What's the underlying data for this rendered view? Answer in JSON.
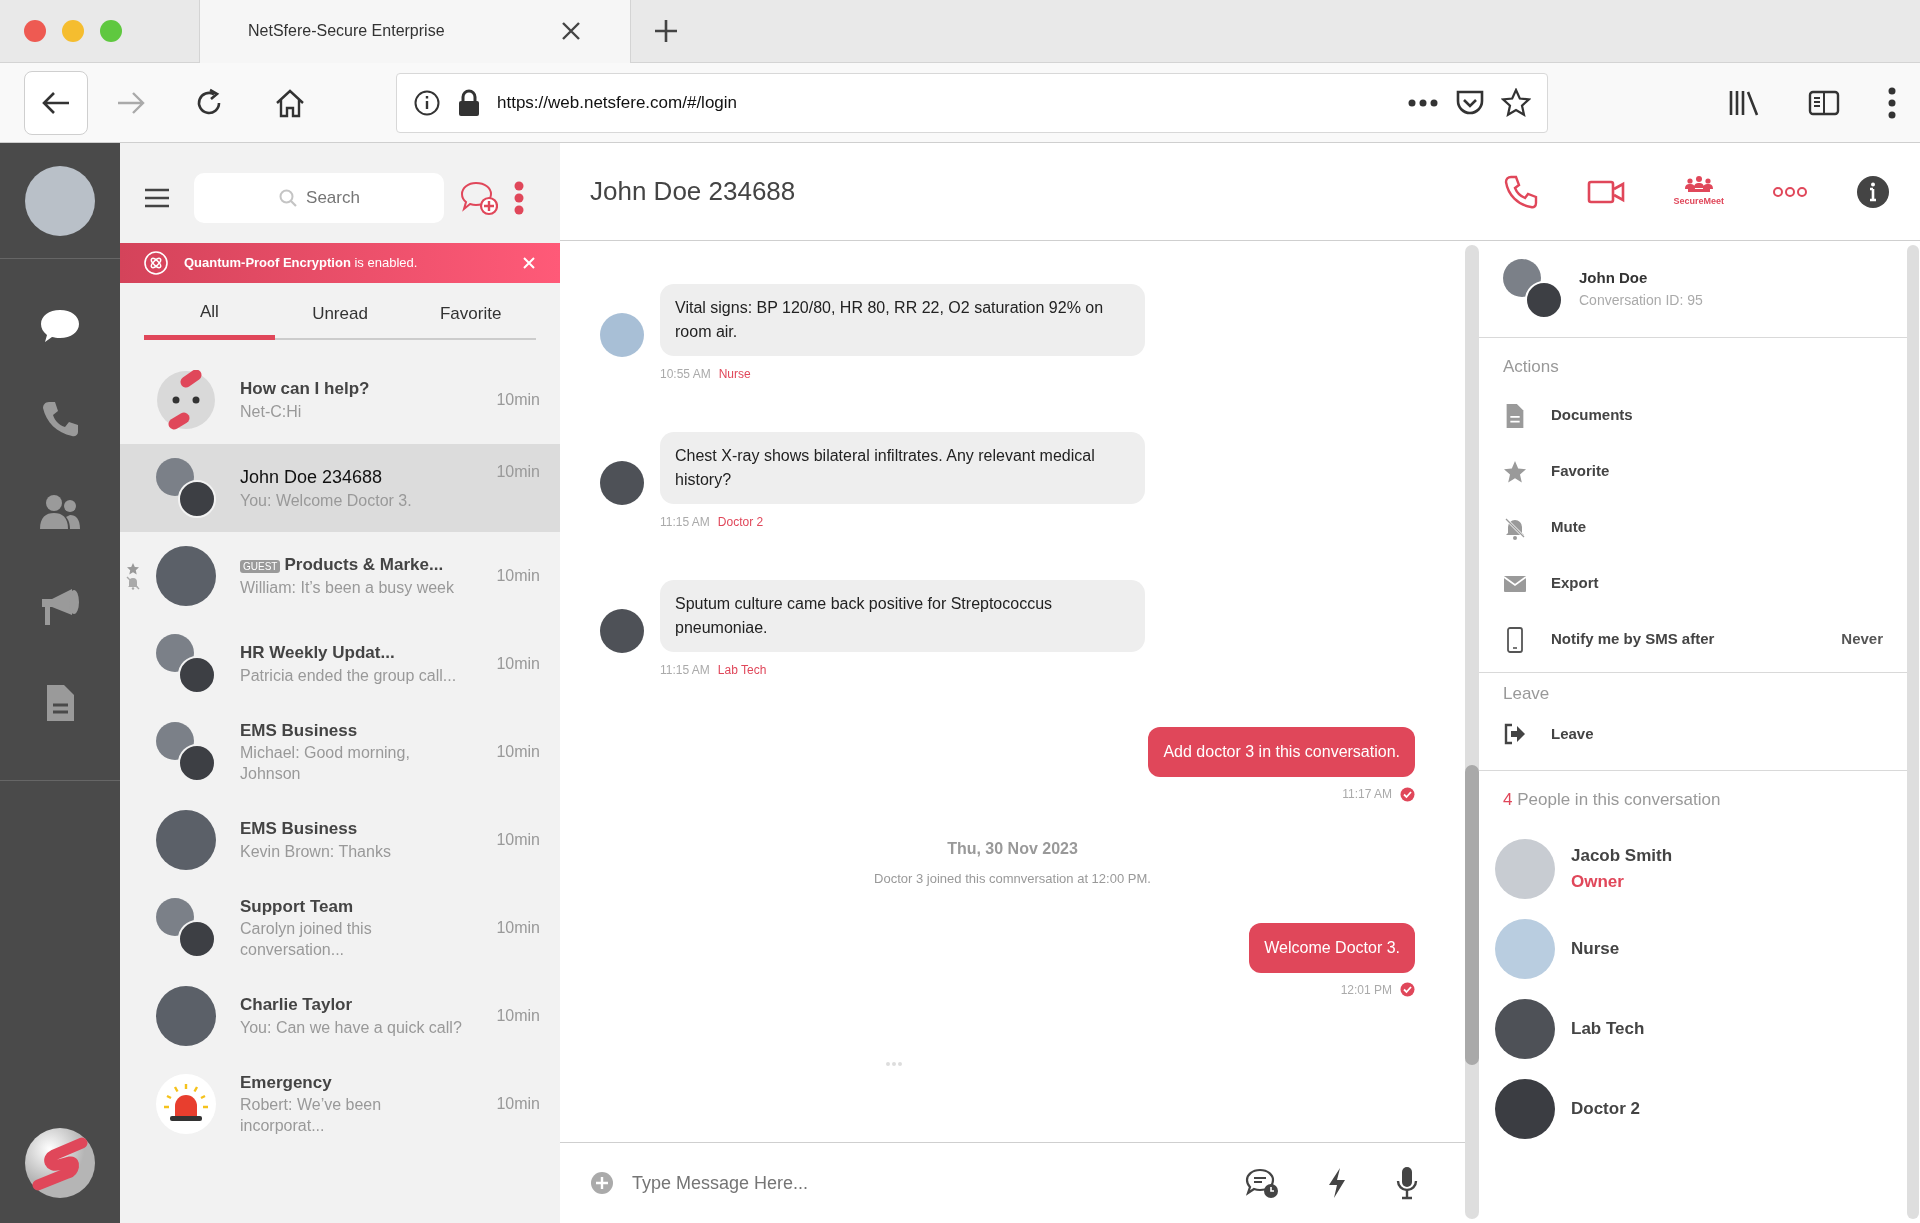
{
  "browser": {
    "tab_title": "NetSfere-Secure Enterprise",
    "url": "https://web.netsfere.com/#/login"
  },
  "sidebar": {
    "items": [
      {
        "kind": "chat",
        "selected": true
      },
      {
        "kind": "phone",
        "selected": false
      },
      {
        "kind": "contacts",
        "selected": false
      },
      {
        "kind": "broadcast",
        "selected": false
      },
      {
        "kind": "documents",
        "selected": false
      }
    ]
  },
  "chat_list": {
    "search": {
      "placeholder": "Search"
    },
    "banner": {
      "text": "**Quantum-Proof Encryption** is enabled."
    },
    "tabs": [
      {
        "label": "All",
        "selected": true
      },
      {
        "label": "Unread",
        "selected": false
      },
      {
        "label": "Favorite",
        "selected": false
      }
    ],
    "conversations": [
      {
        "title": "How can I help?",
        "preview": "Net-C:Hi",
        "time": "10min",
        "kind": "bot",
        "selected": false,
        "favorite": false,
        "muted": false
      },
      {
        "title": "John Doe 234688",
        "preview": "You: Welcome Doctor 3.",
        "time": "10min",
        "kind": "pair",
        "selected": true,
        "favorite": false,
        "muted": false
      },
      {
        "title": "Products & Marke...",
        "badge": "GUEST",
        "preview": "William: It’s been a busy week",
        "time": "10min",
        "kind": "single",
        "selected": false,
        "favorite": true,
        "muted": true
      },
      {
        "title": "HR Weekly Updat...",
        "preview": "Patricia ended the group call...",
        "time": "10min",
        "kind": "pair",
        "selected": false,
        "favorite": false,
        "muted": false
      },
      {
        "title": "EMS Business",
        "preview": "Michael: Good morning, Johnson",
        "time": "10min",
        "kind": "pair",
        "selected": false,
        "favorite": false,
        "muted": false
      },
      {
        "title": "EMS Business",
        "preview": "Kevin Brown: Thanks",
        "time": "10min",
        "kind": "single",
        "selected": false,
        "favorite": false,
        "muted": false
      },
      {
        "title": "Support Team",
        "preview": "Carolyn joined this conversation...",
        "time": "10min",
        "kind": "pair",
        "selected": false,
        "favorite": false,
        "muted": false
      },
      {
        "title": "Charlie Taylor",
        "preview": "You: Can we have a quick call?",
        "time": "10min",
        "kind": "single",
        "selected": false,
        "favorite": false,
        "muted": false
      },
      {
        "title": "Emergency",
        "preview": "Robert: We’ve been incorporat...",
        "time": "10min",
        "kind": "siren",
        "selected": false,
        "favorite": false,
        "muted": false
      }
    ]
  },
  "conversation": {
    "title": "John Doe 234688",
    "securemeet_label": "SecureMeet",
    "messages": [
      {
        "kind": "incoming",
        "text": "Vital signs: BP 120/80, HR 80, RR 22, O2 saturation 92% on room air.",
        "time": "10:55 AM",
        "sender": "Nurse"
      },
      {
        "kind": "incoming",
        "text": "Chest X-ray shows bilateral infiltrates. Any relevant medical history?",
        "time": "11:15 AM",
        "sender": "Doctor 2"
      },
      {
        "kind": "incoming",
        "text": "Sputum culture came back positive for Streptococcus pneumoniae.",
        "time": "11:15 AM",
        "sender": "Lab Tech"
      },
      {
        "kind": "outgoing",
        "text": "Add doctor 3 in this conversation.",
        "time": "11:17 AM",
        "delivered": true
      },
      {
        "kind": "date",
        "text": "Thu, 30 Nov 2023"
      },
      {
        "kind": "system",
        "text": "Doctor 3 joined this comnversation at 12:00 PM."
      },
      {
        "kind": "outgoing",
        "text": "Welcome Doctor 3.",
        "time": "12:01 PM",
        "delivered": true
      },
      {
        "kind": "typing"
      }
    ],
    "composer": {
      "placeholder": "Type Message Here..."
    }
  },
  "details": {
    "name": "John Doe",
    "conversation_id": "Conversation ID: 95",
    "actions_heading": "Actions",
    "actions": [
      {
        "kind": "documents",
        "label": "Documents"
      },
      {
        "kind": "favorite",
        "label": "Favorite"
      },
      {
        "kind": "mute",
        "label": "Mute"
      },
      {
        "kind": "export",
        "label": "Export"
      },
      {
        "kind": "sms",
        "label": "Notify me by SMS after",
        "value": "Never"
      }
    ],
    "leave_heading": "Leave",
    "leave_label": "Leave",
    "people_count": "4",
    "people_heading": "People in this conversation",
    "people": [
      {
        "name": "Jacob Smith",
        "role": "Owner"
      },
      {
        "name": "Nurse"
      },
      {
        "name": "Lab Tech"
      },
      {
        "name": "Doctor 2"
      }
    ]
  }
}
